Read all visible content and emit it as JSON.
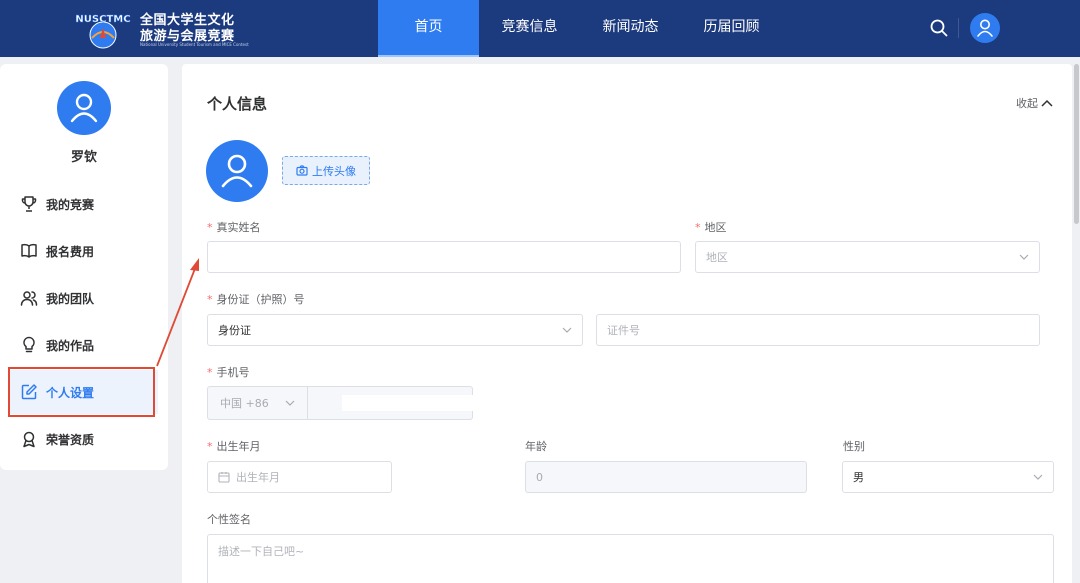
{
  "header": {
    "logo": {
      "badge_text": "NUSCTMC",
      "title_line1": "全国大学生文化",
      "title_line2": "旅游与会展竞赛",
      "subtitle": "National University Student Tourism and MICE Contest"
    },
    "nav": [
      {
        "label": "首页",
        "active": true
      },
      {
        "label": "竞赛信息",
        "active": false
      },
      {
        "label": "新闻动态",
        "active": false
      },
      {
        "label": "历届回顾",
        "active": false
      }
    ],
    "icons": [
      "search-icon",
      "user-avatar-icon"
    ]
  },
  "sidebar": {
    "user_name": "罗钦",
    "items": [
      {
        "label": "我的竞赛",
        "icon": "trophy-icon",
        "active": false
      },
      {
        "label": "报名费用",
        "icon": "book-icon",
        "active": false
      },
      {
        "label": "我的团队",
        "icon": "team-icon",
        "active": false
      },
      {
        "label": "我的作品",
        "icon": "lightbulb-icon",
        "active": false
      },
      {
        "label": "个人设置",
        "icon": "edit-icon",
        "active": true
      },
      {
        "label": "荣誉资质",
        "icon": "award-icon",
        "active": false
      }
    ]
  },
  "form": {
    "title": "个人信息",
    "collapse_label": "收起",
    "upload_label": "上传头像",
    "real_name": {
      "label": "真实姓名",
      "required": true,
      "value": ""
    },
    "region": {
      "label": "地区",
      "required": true,
      "placeholder": "地区"
    },
    "id": {
      "label": "身份证（护照）号",
      "required": true,
      "type_value": "身份证",
      "number_placeholder": "证件号"
    },
    "phone": {
      "label": "手机号",
      "required": true,
      "country_code": "中国 +86"
    },
    "birth": {
      "label": "出生年月",
      "required": true,
      "placeholder": "出生年月"
    },
    "age": {
      "label": "年龄",
      "value": "0"
    },
    "gender": {
      "label": "性别",
      "value": "男"
    },
    "signature": {
      "label": "个性签名",
      "placeholder": "描述一下自己吧~"
    }
  },
  "colors": {
    "header_bg": "#1c3a7e",
    "accent": "#2f7cf0",
    "annotation_red": "#e04a35"
  }
}
